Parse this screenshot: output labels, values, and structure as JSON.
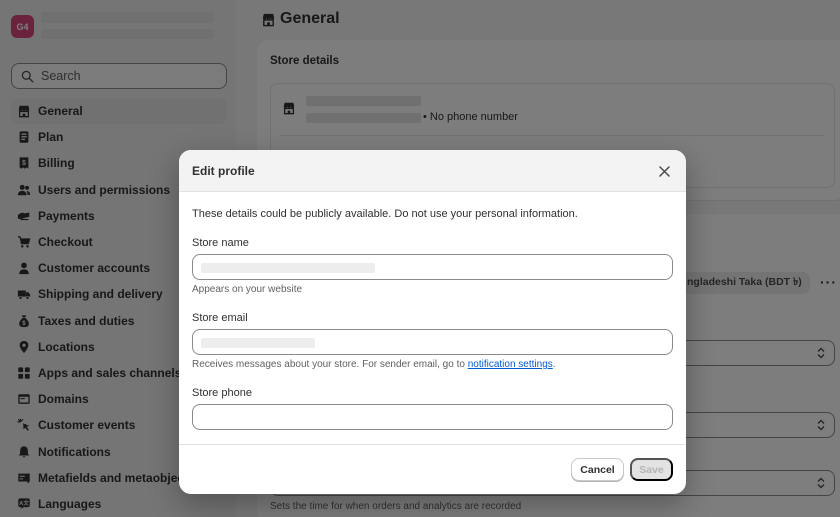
{
  "store": {
    "avatar_initials": "G4"
  },
  "search": {
    "placeholder": "Search"
  },
  "sidebar": {
    "items": [
      {
        "label": "General",
        "icon": "store-icon",
        "active": true
      },
      {
        "label": "Plan",
        "icon": "plan-icon"
      },
      {
        "label": "Billing",
        "icon": "billing-icon"
      },
      {
        "label": "Users and permissions",
        "icon": "users-icon"
      },
      {
        "label": "Payments",
        "icon": "payments-icon"
      },
      {
        "label": "Checkout",
        "icon": "cart-icon"
      },
      {
        "label": "Customer accounts",
        "icon": "person-icon"
      },
      {
        "label": "Shipping and delivery",
        "icon": "truck-icon"
      },
      {
        "label": "Taxes and duties",
        "icon": "tax-bag-icon"
      },
      {
        "label": "Locations",
        "icon": "location-pin-icon"
      },
      {
        "label": "Apps and sales channels",
        "icon": "apps-icon"
      },
      {
        "label": "Domains",
        "icon": "domain-icon"
      },
      {
        "label": "Customer events",
        "icon": "cursor-click-icon"
      },
      {
        "label": "Notifications",
        "icon": "bell-icon"
      },
      {
        "label": "Metafields and metaobjects",
        "icon": "metafields-icon"
      },
      {
        "label": "Languages",
        "icon": "language-icon"
      }
    ]
  },
  "page": {
    "title": "General",
    "store_details": {
      "heading": "Store details",
      "phone_status": "• No phone number"
    },
    "currency_pill": "ngladeshi Taka (BDT ৳)",
    "more_actions": "···",
    "timezone_help": "Sets the time for when orders and analytics are recorded"
  },
  "modal": {
    "title": "Edit profile",
    "notice": "These details could be publicly available. Do not use your personal information.",
    "store_name": {
      "label": "Store name",
      "help": "Appears on your website"
    },
    "store_email": {
      "label": "Store email",
      "help_prefix": "Receives messages about your store. For sender email, go to ",
      "help_link": "notification settings",
      "help_suffix": "."
    },
    "store_phone": {
      "label": "Store phone",
      "value": ""
    },
    "cancel_label": "Cancel",
    "save_label": "Save"
  },
  "colors": {
    "avatar": "#d6457a",
    "link": "#005bd3",
    "sidebar_bg": "#ebebeb",
    "overlay": "rgba(0,0,0,0.5)"
  }
}
